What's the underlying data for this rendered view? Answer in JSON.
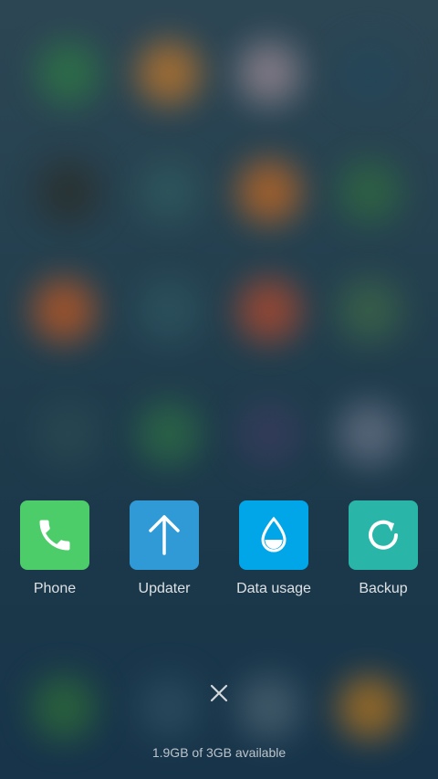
{
  "apps": [
    {
      "label": "Phone",
      "icon": "phone-icon",
      "color": "#4dcc6a"
    },
    {
      "label": "Updater",
      "icon": "arrow-up-icon",
      "color": "#2f9ad6"
    },
    {
      "label": "Data usage",
      "icon": "water-drop-icon",
      "color": "#00a6e8"
    },
    {
      "label": "Backup",
      "icon": "refresh-icon",
      "color": "#29b6a8"
    }
  ],
  "close": {
    "icon": "close-icon"
  },
  "storage": {
    "text": "1.9GB of 3GB available"
  }
}
